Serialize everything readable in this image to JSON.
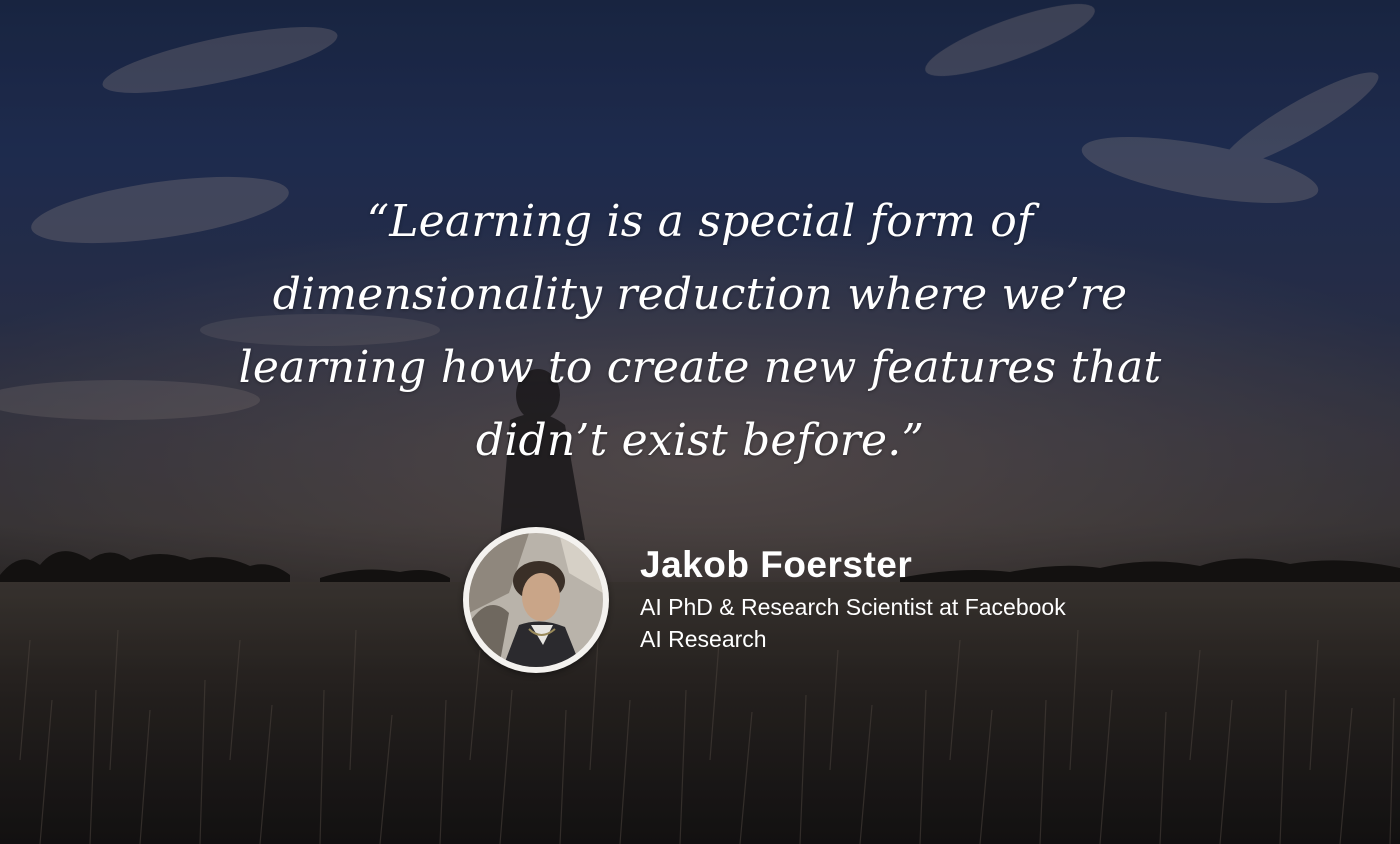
{
  "quote": {
    "lines": [
      "“Learning is a special form of",
      "dimensionality reduction where we’re",
      "learning how to create new features that",
      "didn’t exist before.”"
    ]
  },
  "author": {
    "name": "Jakob Foerster",
    "title_lines": [
      "AI PhD & Research Scientist at Facebook",
      "AI Research"
    ]
  },
  "colors": {
    "sky_top": "#1c2a4a",
    "horizon": "#3e3a3a",
    "field": "#1d1a16",
    "text": "#ffffff"
  }
}
